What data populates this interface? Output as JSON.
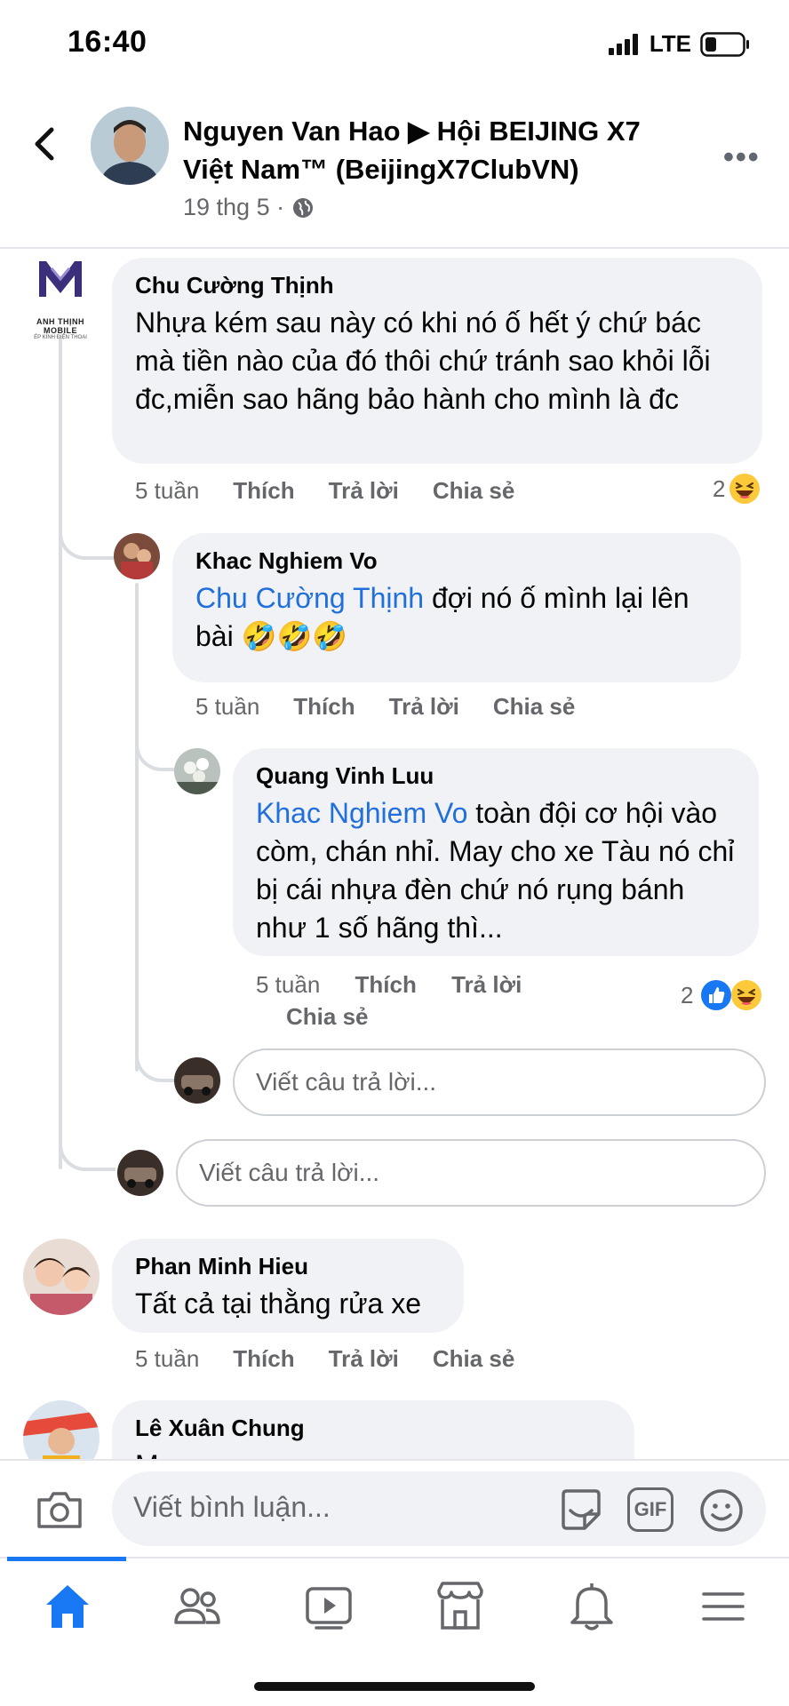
{
  "status_bar": {
    "time": "16:40",
    "network": "LTE"
  },
  "header": {
    "title": "Nguyen Van Hao ▶ Hội BEIJING X7 Việt Nam™ (BeijingX7ClubVN)",
    "meta": "19 thg 5 ·"
  },
  "actions": {
    "time": "5 tuần",
    "like": "Thích",
    "reply": "Trả lời",
    "share": "Chia sẻ"
  },
  "comments": [
    {
      "author": "Chu Cường Thịnh",
      "avatar_caption": "ANH THỊNH MOBILE",
      "avatar_subcaption": "ÉP KÍNH ĐIỆN THOẠI",
      "text": "Nhựa kém sau này có khi nó ố hết ý chứ bác mà tiền nào của đó thôi chứ tránh sao khỏi lỗi đc,miễn sao hãng bảo hành cho mình là đc",
      "reaction_count": "2"
    },
    {
      "author": "Khac Nghiem Vo",
      "mention": "Chu Cường Thịnh",
      "text": " đợi nó ố mình lại lên bài 🤣🤣🤣"
    },
    {
      "author": "Quang Vinh Luu",
      "mention": "Khac Nghiem Vo",
      "text": " toàn đội cơ hội vào còm, chán nhỉ. May cho xe Tàu nó chỉ bị cái nhựa đèn chứ nó rụng bánh như 1 số hãng thì...",
      "reaction_count": "2"
    },
    {
      "author": "Phan Minh Hieu",
      "text": "Tất cả tại thằng rửa xe"
    },
    {
      "author": "Lê Xuân Chung",
      "text": "M"
    }
  ],
  "reply_placeholder": "Viết câu trả lời...",
  "composer": {
    "placeholder": "Viết bình luận...",
    "gif_label": "GIF"
  },
  "colors": {
    "accent": "#1877f2",
    "mention": "#216fdb",
    "bubble": "#f0f2f5"
  }
}
